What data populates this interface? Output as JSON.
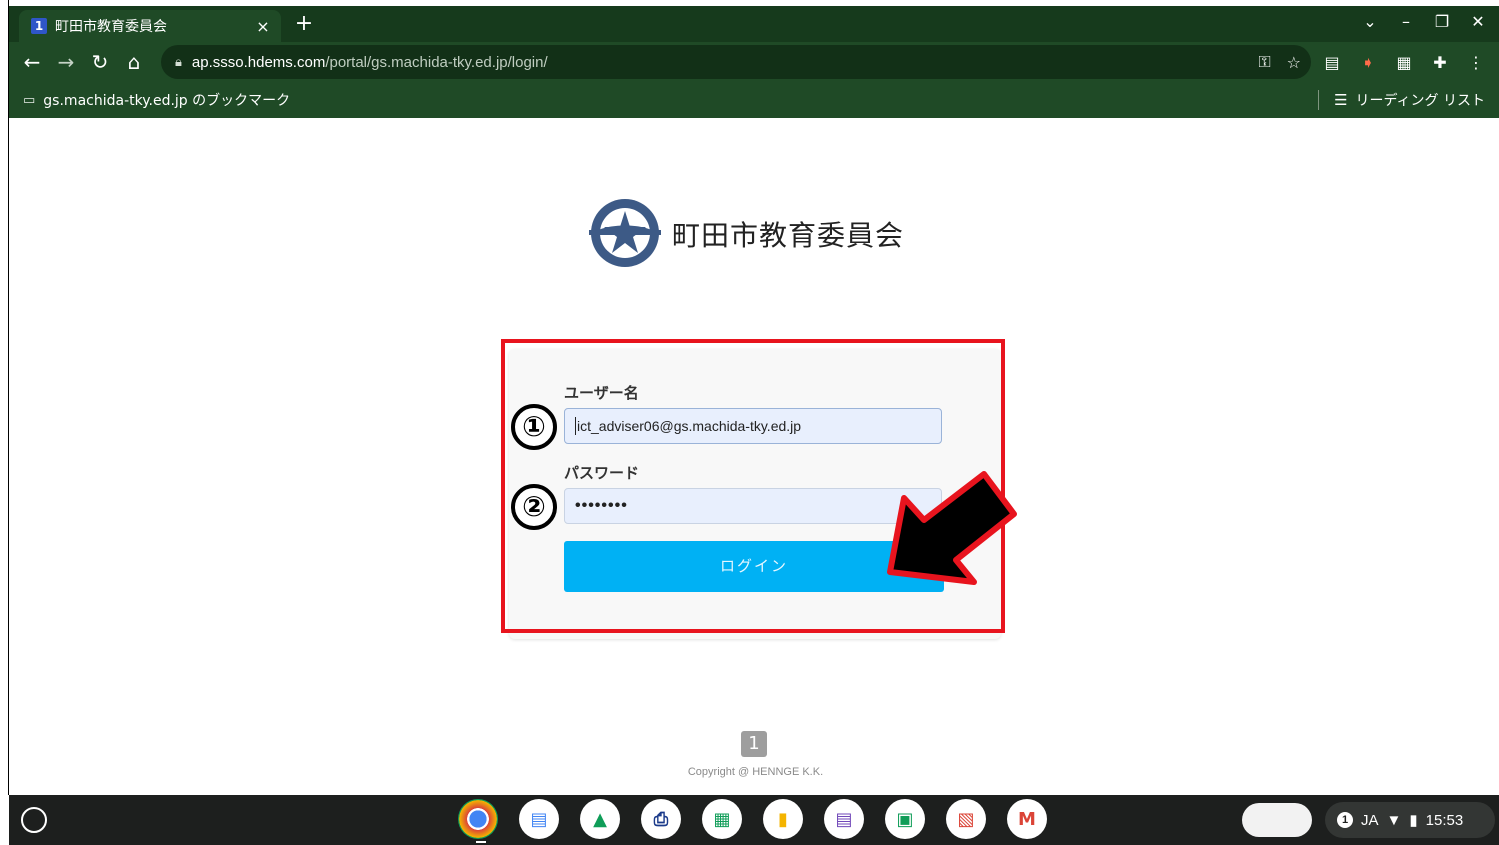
{
  "browser": {
    "tab": {
      "favicon": "1",
      "title": "町田市教育委員会",
      "close": "×"
    },
    "new_tab": "+",
    "window_controls": [
      "⌄",
      "–",
      "❐",
      "✕"
    ],
    "nav": {
      "back": "←",
      "forward": "→",
      "reload": "↻",
      "home": "⌂"
    },
    "address": {
      "host": "ap.ssso.hdems.com",
      "path": "/portal/gs.machida-tky.ed.jp/login/"
    },
    "bookmarks": {
      "folder_label": "gs.machida-tky.ed.jp のブックマーク",
      "reading_list": "リーディング リスト"
    },
    "icons": [
      "key-icon",
      "star-icon",
      "extension-icons"
    ]
  },
  "page": {
    "org_name": "町田市教育委員会",
    "username_label": "ユーザー名",
    "username_value": "ict_adviser06@gs.machida-tky.ed.jp",
    "password_label": "パスワード",
    "password_value": "••••••••",
    "login_button": "ログイン",
    "marker_1": "①",
    "marker_2": "②",
    "footer_logo": "1",
    "copyright": "Copyright @ HENNGE K.K."
  },
  "shelf": {
    "language": "JA",
    "notification_count": "1",
    "time": "15:53"
  },
  "colors": {
    "chrome_green": "#1f4a26",
    "login_blue": "#00b1f4",
    "highlight_red": "#e8141e"
  }
}
